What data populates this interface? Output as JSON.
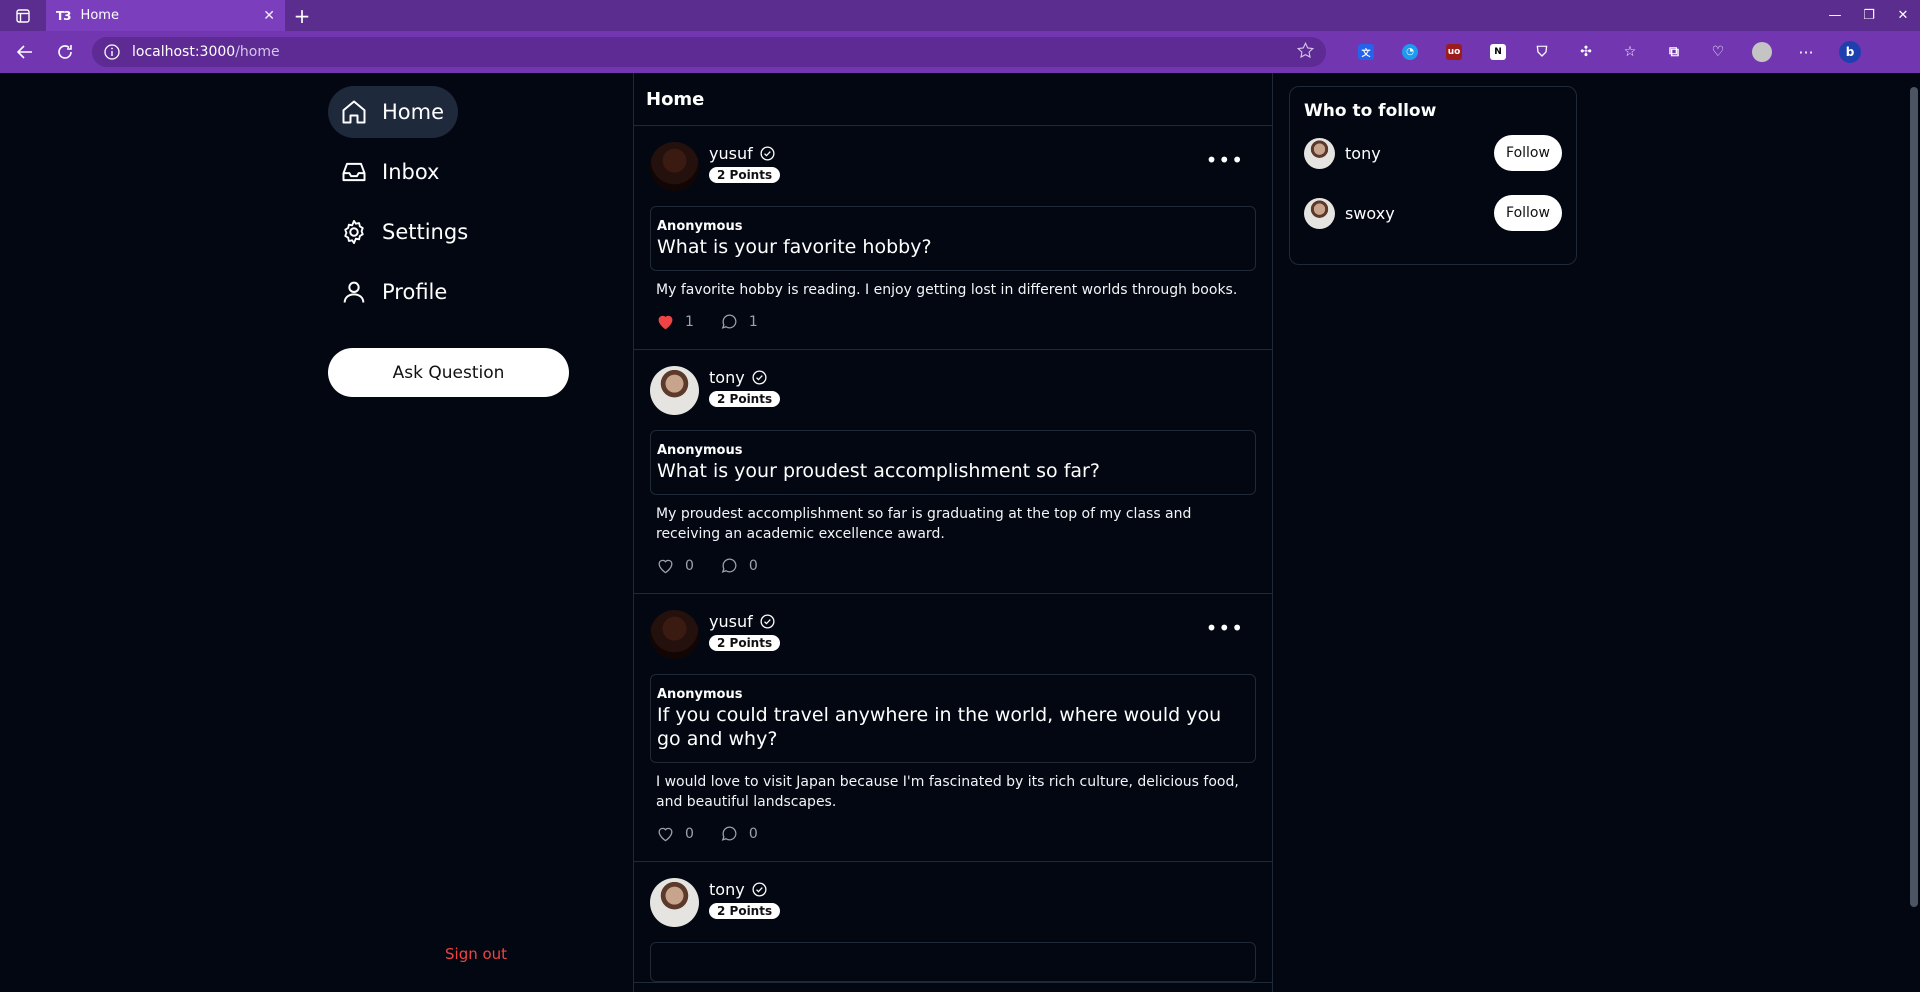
{
  "browser": {
    "tab_title": "Home",
    "tab_favicon": "T3",
    "url_host": "localhost:3000",
    "url_path": "/home"
  },
  "nav": {
    "items": [
      {
        "label": "Home",
        "icon": "home-icon"
      },
      {
        "label": "Inbox",
        "icon": "inbox-icon"
      },
      {
        "label": "Settings",
        "icon": "gear-icon"
      },
      {
        "label": "Profile",
        "icon": "user-icon"
      }
    ],
    "ask_label": "Ask Question",
    "signout_label": "Sign out"
  },
  "feed": {
    "title": "Home",
    "posts": [
      {
        "user": "yusuf",
        "points": "2 Points",
        "question_author": "Anonymous",
        "question": "What is your favorite hobby?",
        "answer": "My favorite hobby is reading. I enjoy getting lost in different worlds through books.",
        "likes": "1",
        "comments": "1"
      },
      {
        "user": "tony",
        "points": "2 Points",
        "question_author": "Anonymous",
        "question": "What is your proudest accomplishment so far?",
        "answer": "My proudest accomplishment so far is graduating at the top of my class and receiving an academic excellence award.",
        "likes": "0",
        "comments": "0"
      },
      {
        "user": "yusuf",
        "points": "2 Points",
        "question_author": "Anonymous",
        "question": "If you could travel anywhere in the world, where would you go and why?",
        "answer": "I would love to visit Japan because I'm fascinated by its rich culture, delicious food, and beautiful landscapes.",
        "likes": "0",
        "comments": "0"
      },
      {
        "user": "tony",
        "points": "2 Points"
      }
    ]
  },
  "who_to_follow": {
    "title": "Who to follow",
    "users": [
      {
        "name": "tony",
        "button": "Follow"
      },
      {
        "name": "swoxy",
        "button": "Follow"
      }
    ]
  },
  "colors": {
    "like_active": "#ef4444",
    "signout": "#ef4444",
    "browser_tab": "#7b3fbd"
  }
}
